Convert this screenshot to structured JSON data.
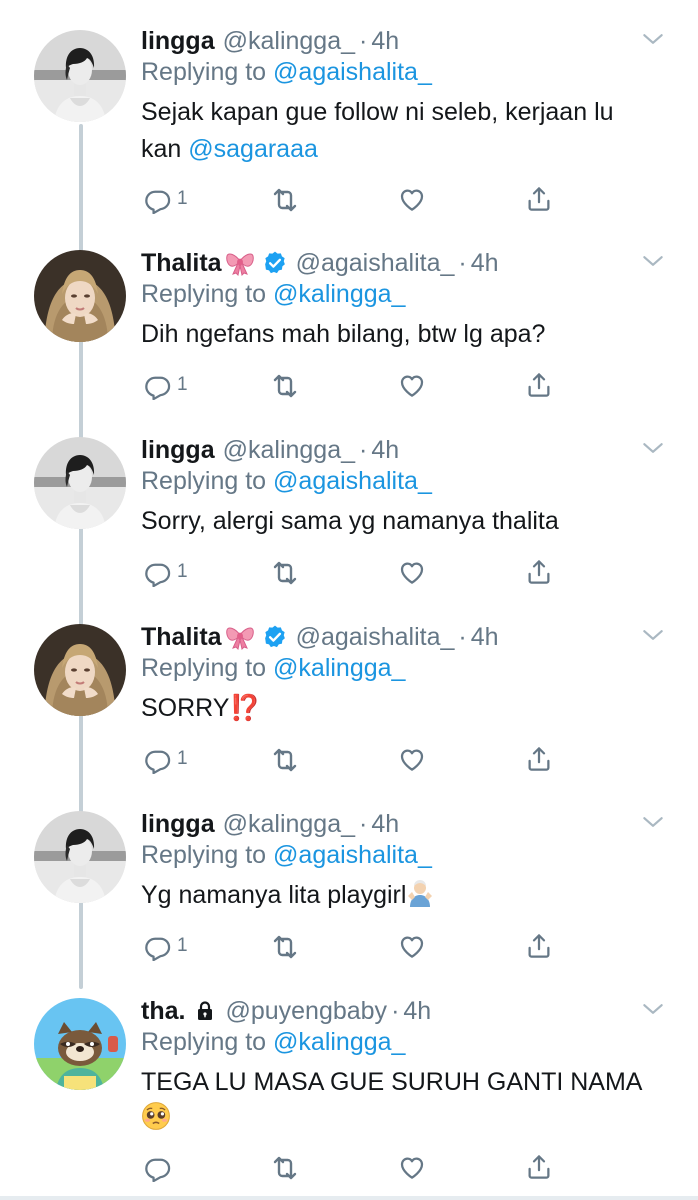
{
  "tweets": [
    {
      "name": "lingga",
      "handle": "@kalingga_",
      "time": "4h",
      "replying_prefix": "Replying to ",
      "replying_to": "@agaishalita_",
      "text_line1": "Sejak kapan gue follow ni seleb, kerjaan lu",
      "text_line2_prefix": "kan ",
      "text_line2_mention": "@sagaraaa",
      "reply_count": "1"
    },
    {
      "name": "Thalita",
      "handle": "@agaishalita_",
      "time": "4h",
      "replying_prefix": "Replying to ",
      "replying_to": "@kalingga_",
      "text": "Dih ngefans mah bilang, btw lg apa?",
      "reply_count": "1"
    },
    {
      "name": "lingga",
      "handle": "@kalingga_",
      "time": "4h",
      "replying_prefix": "Replying to ",
      "replying_to": "@agaishalita_",
      "text": "Sorry, alergi sama yg namanya thalita",
      "reply_count": "1"
    },
    {
      "name": "Thalita",
      "handle": "@agaishalita_",
      "time": "4h",
      "replying_prefix": "Replying to ",
      "replying_to": "@kalingga_",
      "text": "SORRY⁉️",
      "reply_count": "1"
    },
    {
      "name": "lingga",
      "handle": "@kalingga_",
      "time": "4h",
      "replying_prefix": "Replying to ",
      "replying_to": "@agaishalita_",
      "text": "Yg namanya lita playgirl",
      "reply_count": "1"
    },
    {
      "name": "tha.",
      "handle": "@puyengbaby",
      "time": "4h",
      "replying_prefix": "Replying to ",
      "replying_to": "@kalingga_",
      "text_line1": "TEGA LU MASA GUE SURUH GANTI NAMA",
      "reply_count": ""
    }
  ],
  "dot_separator": "·",
  "colors": {
    "link": "#1b95e0",
    "secondary": "#657786",
    "thread_line": "#c4cfd6",
    "verified": "#1da1f2"
  },
  "icons": {
    "reply": "reply-icon",
    "retweet": "retweet-icon",
    "like": "heart-icon",
    "share": "share-icon",
    "more": "chevron-down-icon"
  }
}
